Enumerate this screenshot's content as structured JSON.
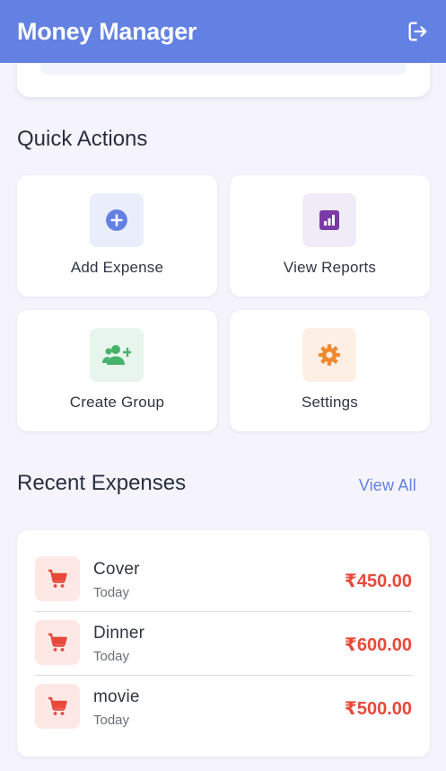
{
  "app": {
    "title": "Money Manager"
  },
  "quick_actions": {
    "title": "Quick Actions",
    "items": [
      {
        "label": "Add Expense",
        "icon": "add-circle-icon",
        "bg": "#eaeefb",
        "color": "#6381e3"
      },
      {
        "label": "View Reports",
        "icon": "bar-chart-icon",
        "bg": "#efecf7",
        "color": "#7b3aa6"
      },
      {
        "label": "Create Group",
        "icon": "group-add-icon",
        "bg": "#e8f5ed",
        "color": "#46b36c"
      },
      {
        "label": "Settings",
        "icon": "gear-icon",
        "bg": "#fdefe4",
        "color": "#ef8a2e"
      }
    ]
  },
  "recent_expenses": {
    "title": "Recent Expenses",
    "view_all": "View All",
    "items": [
      {
        "name": "Cover",
        "date": "Today",
        "amount": "₹450.00",
        "icon": "cart-icon"
      },
      {
        "name": "Dinner",
        "date": "Today",
        "amount": "₹600.00",
        "icon": "cart-icon"
      },
      {
        "name": "movie",
        "date": "Today",
        "amount": "₹500.00",
        "icon": "cart-icon"
      }
    ]
  },
  "colors": {
    "primary": "#6381e3",
    "background": "#f5f4fc",
    "expense_amount": "#e8493b",
    "expense_icon_bg": "#fde8e6"
  }
}
